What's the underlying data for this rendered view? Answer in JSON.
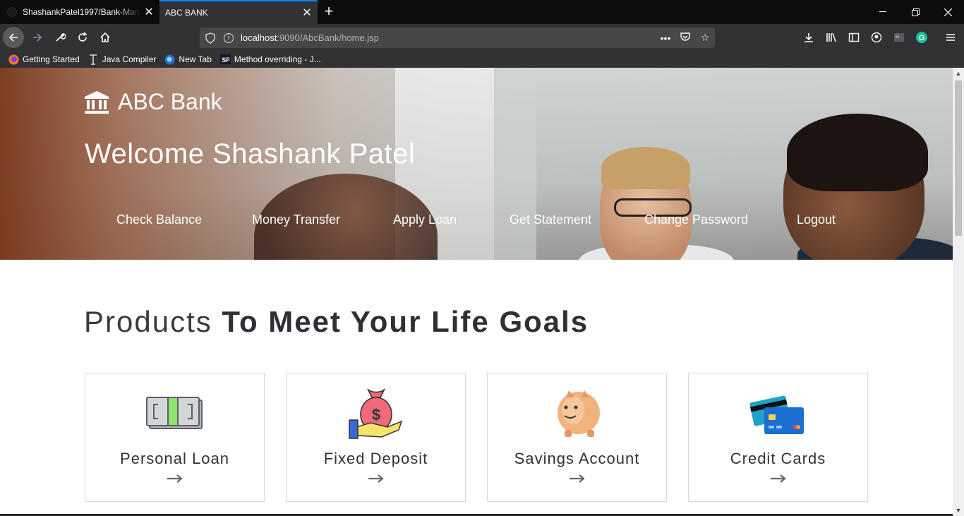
{
  "browser": {
    "tabs": [
      {
        "title": "ShashankPatel1997/Bank-Mana",
        "active": false
      },
      {
        "title": "ABC BANK",
        "active": true
      }
    ],
    "url_host": "localhost",
    "url_rest": ":9090/AbcBank/home.jsp",
    "bookmarks": [
      {
        "label": "Getting Started",
        "icon": "firefox-icon"
      },
      {
        "label": "Java Compiler",
        "icon": "text-cursor-icon"
      },
      {
        "label": "New Tab",
        "icon": "firefox-icon"
      },
      {
        "label": "Method overriding - J...",
        "icon": "sf-icon"
      }
    ],
    "accent_color": "#0a84ff"
  },
  "page": {
    "brand": "ABC Bank",
    "welcome": "Welcome Shashank Patel",
    "menu": [
      "Check Balance",
      "Money Transfer",
      "Apply Loan",
      "Get Statement",
      "Change Password",
      "Logout"
    ],
    "section_title_light": "Products",
    "section_title_bold": "To Meet Your Life Goals",
    "products": [
      {
        "label": "Personal Loan",
        "icon": "cash-icon"
      },
      {
        "label": "Fixed Deposit",
        "icon": "money-bag-icon"
      },
      {
        "label": "Savings Account",
        "icon": "piggy-bank-icon"
      },
      {
        "label": "Credit Cards",
        "icon": "credit-cards-icon"
      }
    ]
  }
}
